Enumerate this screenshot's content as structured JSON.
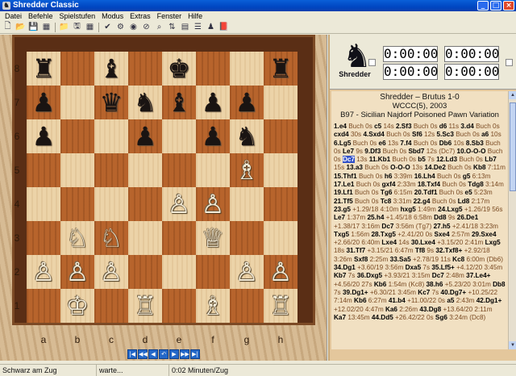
{
  "window": {
    "title": "Shredder Classic"
  },
  "menu": [
    "Datei",
    "Befehle",
    "Spielstufen",
    "Modus",
    "Extras",
    "Fenster",
    "Hilfe"
  ],
  "board": {
    "ranks": [
      "8",
      "7",
      "6",
      "5",
      "4",
      "3",
      "2",
      "1"
    ],
    "files": [
      "a",
      "b",
      "c",
      "d",
      "e",
      "f",
      "g",
      "h"
    ],
    "rows": [
      [
        "♜",
        "",
        "♝",
        "",
        "♚",
        "",
        "",
        "♜"
      ],
      [
        "♟",
        "",
        "♛",
        "♞",
        "♝",
        "♟",
        "♟",
        ""
      ],
      [
        "♟",
        "",
        "",
        "♟",
        "",
        "♟",
        "♞",
        ""
      ],
      [
        "",
        "",
        "",
        "",
        "",
        "",
        "♗",
        ""
      ],
      [
        "",
        "",
        "",
        "",
        "♙",
        "♙",
        "",
        ""
      ],
      [
        "",
        "♘",
        "♘",
        "",
        "",
        "♕",
        "",
        ""
      ],
      [
        "♙",
        "♙",
        "♙",
        "",
        "",
        "",
        "♙",
        "♙"
      ],
      [
        "",
        "♔",
        "",
        "♖",
        "",
        "♗",
        "",
        "♖"
      ]
    ],
    "colors": [
      [
        "b",
        "",
        "b",
        "",
        "b",
        "",
        "",
        "b"
      ],
      [
        "b",
        "",
        "b",
        "b",
        "b",
        "b",
        "b",
        ""
      ],
      [
        "b",
        "",
        "",
        "b",
        "",
        "b",
        "b",
        ""
      ],
      [
        "",
        "",
        "",
        "",
        "",
        "",
        "w",
        ""
      ],
      [
        "",
        "",
        "",
        "",
        "w",
        "w",
        "",
        ""
      ],
      [
        "",
        "w",
        "w",
        "",
        "",
        "w",
        "",
        ""
      ],
      [
        "w",
        "w",
        "w",
        "",
        "",
        "",
        "w",
        "w"
      ],
      [
        "",
        "w",
        "",
        "w",
        "",
        "w",
        "",
        "w"
      ]
    ]
  },
  "logo": {
    "name": "Shredder"
  },
  "clocks": {
    "c1": "0:00:00",
    "c2": "0:00:00",
    "c3": "0:00:00",
    "c4": "0:00:00"
  },
  "game": {
    "players": "Shredder – Brutus 1-0",
    "event": "WCCC(5), 2003",
    "opening": "B97 - Sicilian Najdorf Poisoned Pawn Variation"
  },
  "moves": [
    [
      "1.e4",
      "Buch 0s"
    ],
    [
      "c5",
      "14s"
    ],
    [
      "2.Sf3",
      "Buch 0s"
    ],
    [
      "d6",
      "11s"
    ],
    [
      "3.d4",
      "Buch 0s"
    ],
    [
      "cxd4",
      "30s"
    ],
    [
      "4.Sxd4",
      "Buch 0s"
    ],
    [
      "Sf6",
      "12s"
    ],
    [
      "5.Sc3",
      "Buch 0s"
    ],
    [
      "a6",
      "10s"
    ],
    [
      "6.Lg5",
      "Buch 0s"
    ],
    [
      "e6",
      "13s"
    ],
    [
      "7.f4",
      "Buch 0s"
    ],
    [
      "Db6",
      "10s"
    ],
    [
      "8.Sb3",
      "Buch 0s"
    ],
    [
      "Le7",
      "9s"
    ],
    [
      "9.Df3",
      "Buch 0s"
    ],
    [
      "Sbd7",
      "12s (Dc7)"
    ],
    [
      "10.O-O-O",
      "Buch 0s"
    ],
    [
      "Dc7",
      "13s"
    ],
    [
      "11.Kb1",
      "Buch 0s"
    ],
    [
      "b5",
      "7s"
    ],
    [
      "12.Ld3",
      "Buch 0s"
    ],
    [
      "Lb7",
      "15s"
    ],
    [
      "13.a3",
      "Buch 0s"
    ],
    [
      "O-O-O",
      "13s"
    ],
    [
      "14.De2",
      "Buch 0s"
    ],
    [
      "Kb8",
      "7:11m"
    ],
    [
      "15.Thf1",
      "Buch 0s"
    ],
    [
      "h6",
      "3:39m"
    ],
    [
      "16.Lh4",
      "Buch 0s"
    ],
    [
      "g5",
      "6:13m"
    ],
    [
      "17.Le1",
      "Buch 0s"
    ],
    [
      "gxf4",
      "2:33m"
    ],
    [
      "18.Txf4",
      "Buch 0s"
    ],
    [
      "Tdg8",
      "3:14m"
    ],
    [
      "19.Lf1",
      "Buch 0s"
    ],
    [
      "Tg6",
      "6:15m"
    ],
    [
      "20.Tdf1",
      "Buch 0s"
    ],
    [
      "e5",
      "5:23m"
    ],
    [
      "21.Tf5",
      "Buch 0s"
    ],
    [
      "Tc8",
      "3:31m"
    ],
    [
      "22.g4",
      "Buch 0s"
    ],
    [
      "Ld8",
      "2:17m"
    ],
    [
      "23.g5",
      "+1.29/18 4:10m"
    ],
    [
      "hxg5",
      "1:49m"
    ],
    [
      "24.Lxg5",
      "+1.26/19 56s"
    ],
    [
      "Le7",
      "1:37m"
    ],
    [
      "25.h4",
      "+1.45/18 6:58m"
    ],
    [
      "Dd8",
      "9s"
    ],
    [
      "26.De1",
      "+1.38/17 3:16m"
    ],
    [
      "Dc7",
      "3:56m (Tg7)"
    ],
    [
      "27.h5",
      "+2.41/18 3:23m"
    ],
    [
      "Txg5",
      "1:56m"
    ],
    [
      "28.Txg5",
      "+2.41/20 0s"
    ],
    [
      "Sxe4",
      "2:57m"
    ],
    [
      "29.Sxe4",
      "+2.66/20 6:40m"
    ],
    [
      "Lxe4",
      "14s"
    ],
    [
      "30.Lxe4",
      "+3.15/20 2:41m"
    ],
    [
      "Lxg5",
      "18s"
    ],
    [
      "31.Tf7",
      "+3.15/21 6:47m"
    ],
    [
      "Tf8",
      "9s"
    ],
    [
      "32.Txf8+",
      "+2.92/18 3:26m"
    ],
    [
      "Sxf8",
      "2:25m"
    ],
    [
      "33.Sa5",
      "+2.78/19 11s"
    ],
    [
      "Kc8",
      "6:00m (Db6)"
    ],
    [
      "34.Dg1",
      "+3.60/19 3:56m"
    ],
    [
      "Dxa5",
      "7s"
    ],
    [
      "35.Lf5+",
      "+4.12/20 3:45m"
    ],
    [
      "Kb7",
      "7s"
    ],
    [
      "36.Dxg5",
      "+3.93/21 3:15m"
    ],
    [
      "Dc7",
      "2:48m"
    ],
    [
      "37.Le4+",
      "+4.56/20 27s"
    ],
    [
      "Kb6",
      "1:54m (Kc8)"
    ],
    [
      "38.h6",
      "+5.23/20 3:01m"
    ],
    [
      "Db8",
      "7s"
    ],
    [
      "39.Dg1+",
      "+6.30/21 3:45m"
    ],
    [
      "Kc7",
      "7s"
    ],
    [
      "40.Dg7+",
      "+10.25/22 7:14m"
    ],
    [
      "Kb6",
      "6:27m"
    ],
    [
      "41.b4",
      "+11.00/22 0s"
    ],
    [
      "a5",
      "2:43m"
    ],
    [
      "42.Dg1+",
      "+12.02/20 4:47m"
    ],
    [
      "Ka6",
      "2:26m"
    ],
    [
      "43.Dg8",
      "+13.64/20 2:11m"
    ],
    [
      "Ka7",
      "13:45m"
    ],
    [
      "44.Dd5",
      "+26.42/22 0s"
    ],
    [
      "Sg6",
      "3:24m (Dc8)"
    ]
  ],
  "current_move_index": 19,
  "status": {
    "side": "Schwarz am Zug",
    "state": "warte...",
    "time": "0:02 Minuten/Zug"
  },
  "accent": "#3050c8"
}
